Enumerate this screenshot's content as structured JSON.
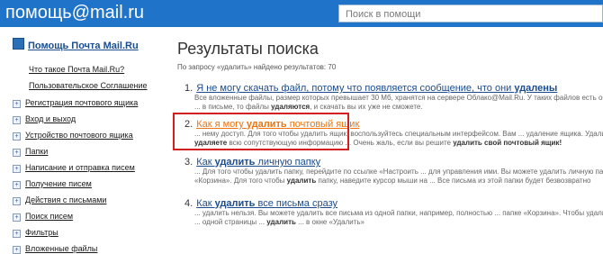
{
  "header": {
    "logo": "помощь@mail.ru",
    "search_placeholder": "Поиск в помощи"
  },
  "sidebar": {
    "title": "Помощь Почта Mail.Ru",
    "items": [
      {
        "label": "Что такое Почта Mail.Ru?",
        "expander": false
      },
      {
        "label": "Пользовательское Соглашение",
        "expander": false
      },
      {
        "label": "Регистрация почтового ящика",
        "expander": true
      },
      {
        "label": "Вход и выход",
        "expander": true
      },
      {
        "label": "Устройство почтового ящика",
        "expander": true
      },
      {
        "label": "Папки",
        "expander": true
      },
      {
        "label": "Написание и отправка писем",
        "expander": true
      },
      {
        "label": "Получение писем",
        "expander": true
      },
      {
        "label": "Действия с письмами",
        "expander": true
      },
      {
        "label": "Поиск писем",
        "expander": true
      },
      {
        "label": "Фильтры",
        "expander": true
      },
      {
        "label": "Вложенные файлы",
        "expander": true
      }
    ]
  },
  "main": {
    "title": "Результаты поиска",
    "query_info": "По запросу «удалить» найдено результатов: 70",
    "results": [
      {
        "num": "1.",
        "link_pre": "Я не могу скачать файл, потому что появляется сообщение, что они ",
        "link_bold": "удалены",
        "link_post": "",
        "snippet1": "Все вложенные файлы, размер которых превышает 30 Мб, хранятся на сервере Облако@Mail.Ru. У таких файлов есть огран",
        "snippet2": "... в письме, то файлы ",
        "snippet2b": "удаляются",
        "snippet2c": ", и скачать вы их уже не сможете."
      },
      {
        "num": "2.",
        "link_pre": "Как я могу ",
        "link_bold": "удалить",
        "link_post": " почтовый ящик",
        "snippet1": "... нему доступ. Для того чтобы удалить ящик, воспользуйтесь специальным интерфейсом. Вам ... удаление ящика. Удалить",
        "snippet2": "удаляете",
        "snippet2b": " всю сопутствующую информацию ... Очень жаль, если вы решите ",
        "snippet2c": "удалить свой почтовый ящик!"
      },
      {
        "num": "3.",
        "link_pre": "Как ",
        "link_bold": "удалить",
        "link_post": " личную папку",
        "snippet1": "... Для того чтобы удалить папку, перейдите по ссылке «Настроить ... для управления ими. Вы можете удалить личную па",
        "snippet2": "«Корзина». Для того чтобы ",
        "snippet2b": "удалить",
        "snippet2c": " папку, наведите курсор мыши на ... Все письма из этой папки будет безвозвратно"
      },
      {
        "num": "4.",
        "link_pre": "Как ",
        "link_bold": "удалить",
        "link_post": " все письма сразу",
        "snippet1": "... удалить нельзя. Вы можете удалить все письма из одной папки, например, полностью ... папке «Корзина». Чтобы удалит",
        "snippet2": "... одной страницы ... ",
        "snippet2b": "удалить",
        "snippet2c": " ... в окне «Удалить»"
      }
    ]
  }
}
